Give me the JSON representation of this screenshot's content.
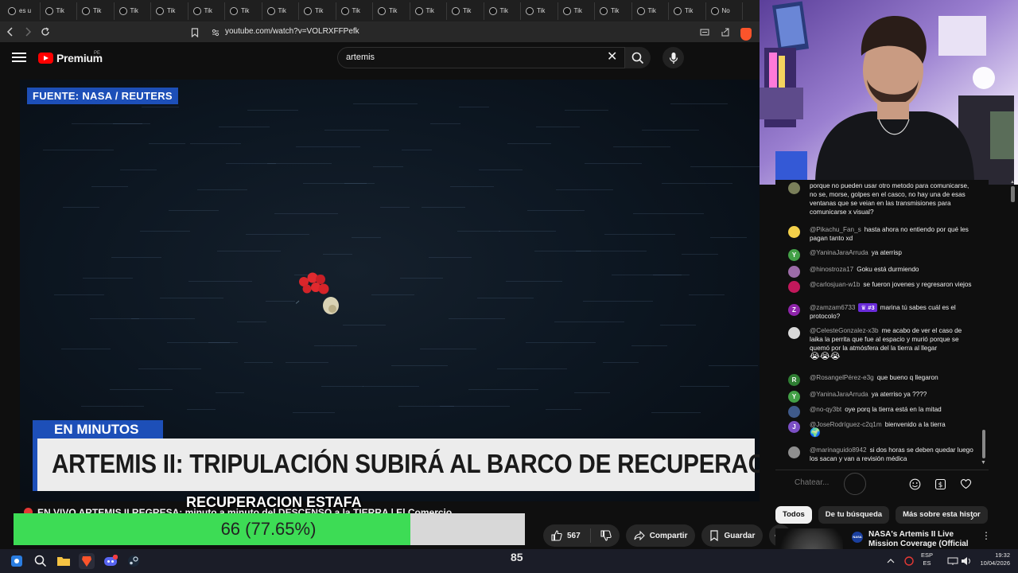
{
  "browser": {
    "tabs": [
      "es u",
      "Tik",
      "Tik",
      "Tik",
      "Tik",
      "Tik",
      "Tik",
      "Tik",
      "Tik",
      "Tik",
      "Tik",
      "Tik",
      "Tik",
      "Tik",
      "Tik",
      "Tik",
      "Tik",
      "Tik",
      "Tik",
      "No"
    ],
    "url": "youtube.com/watch?v=VOLRXFFPefk"
  },
  "youtube": {
    "logo_text": "Premium",
    "region": "PE",
    "search_value": "artemis"
  },
  "video": {
    "source_label": "FUENTE: NASA / REUTERS",
    "ticker_tag": "EN MINUTOS",
    "ticker_headline": "ARTEMIS II: TRIPULACIÓN SUBIRÁ AL BARCO DE RECUPERACIÓN",
    "title": "EN VIVO ARTEMIS II REGRESA: minuto a minuto del DESCENSO a la TIERRA | El Comercio"
  },
  "poll": {
    "title": "RECUPERACION ESTAFA",
    "text": "66 (77.65%)",
    "fraction": 0.7765
  },
  "actions": {
    "likes": "567",
    "share": "Compartir",
    "save": "Guardar"
  },
  "chat": {
    "messages": [
      {
        "author": "",
        "avatar": "",
        "color": "#7a7f5a",
        "text": "porque no pueden usar otro metodo para comunicarse, no se, morse, golpes en el casco, no hay una de esas ventanas que se veian en las transmisiones para comunicarse x visual?"
      },
      {
        "author": "@Pikachu_Fan_s",
        "avatar": "",
        "color": "#f3d04a",
        "text": "hasta ahora no entiendo por qué les pagan tanto xd"
      },
      {
        "author": "@YaninaJaraArruda",
        "avatar": "Y",
        "color": "#43a047",
        "text": "ya aterrisp"
      },
      {
        "author": "@hinostroza17",
        "avatar": "",
        "color": "#9c6ca8",
        "text": "Goku está durmiendo"
      },
      {
        "author": "@carlosjuan-w1b",
        "avatar": "",
        "color": "#c2185b",
        "text": "se fueron jovenes y regresaron viejos"
      },
      {
        "author": "@zamzam6733",
        "avatar": "Z",
        "color": "#8e24aa",
        "badge": "#3",
        "text": "marina tú sabes cuál es el protocolo?"
      },
      {
        "author": "@CelesteGonzalez-x3b",
        "avatar": "",
        "color": "#d9d9d9",
        "text": "me acabo de ver el caso de laika la perrita que fue al espacio y murió porque se quemó por la atmósfera del la tierra al llegar",
        "emoji": "😭😭😭"
      },
      {
        "author": "@RosangelPérez-e3g",
        "avatar": "R",
        "color": "#2e7d32",
        "text": "que bueno q llegaron"
      },
      {
        "author": "@YaninaJaraArruda",
        "avatar": "Y",
        "color": "#43a047",
        "text": "ya aterriso ya ????"
      },
      {
        "author": "@no-qy3bt",
        "avatar": "",
        "color": "#3f5a8a",
        "text": "oye porq la tierra está en la mitad"
      },
      {
        "author": "@JoseRodríguez-c2q1m",
        "avatar": "J",
        "color": "#7b4fc4",
        "text": "bienvenido a la tierra",
        "emoji": "🌍"
      },
      {
        "author": "@marinaguido8942",
        "avatar": "",
        "color": "#8f8f8f",
        "text": "si dos horas se deben quedar luego los sacan y van a revisión médica"
      }
    ],
    "input_placeholder": "Chatear..."
  },
  "chips": [
    "Todos",
    "De tu búsqueda",
    "Más sobre esta histor"
  ],
  "recommended": {
    "title": "NASA's Artemis II Live Mission Coverage (Official Broadcast)",
    "channel_logo": "NASA"
  },
  "taskbar": {
    "widget_number": "85",
    "lang_line1": "ESP",
    "lang_line2": "ES",
    "time": "19:32",
    "date": "10/04/2026",
    "discord_badge": "22"
  }
}
